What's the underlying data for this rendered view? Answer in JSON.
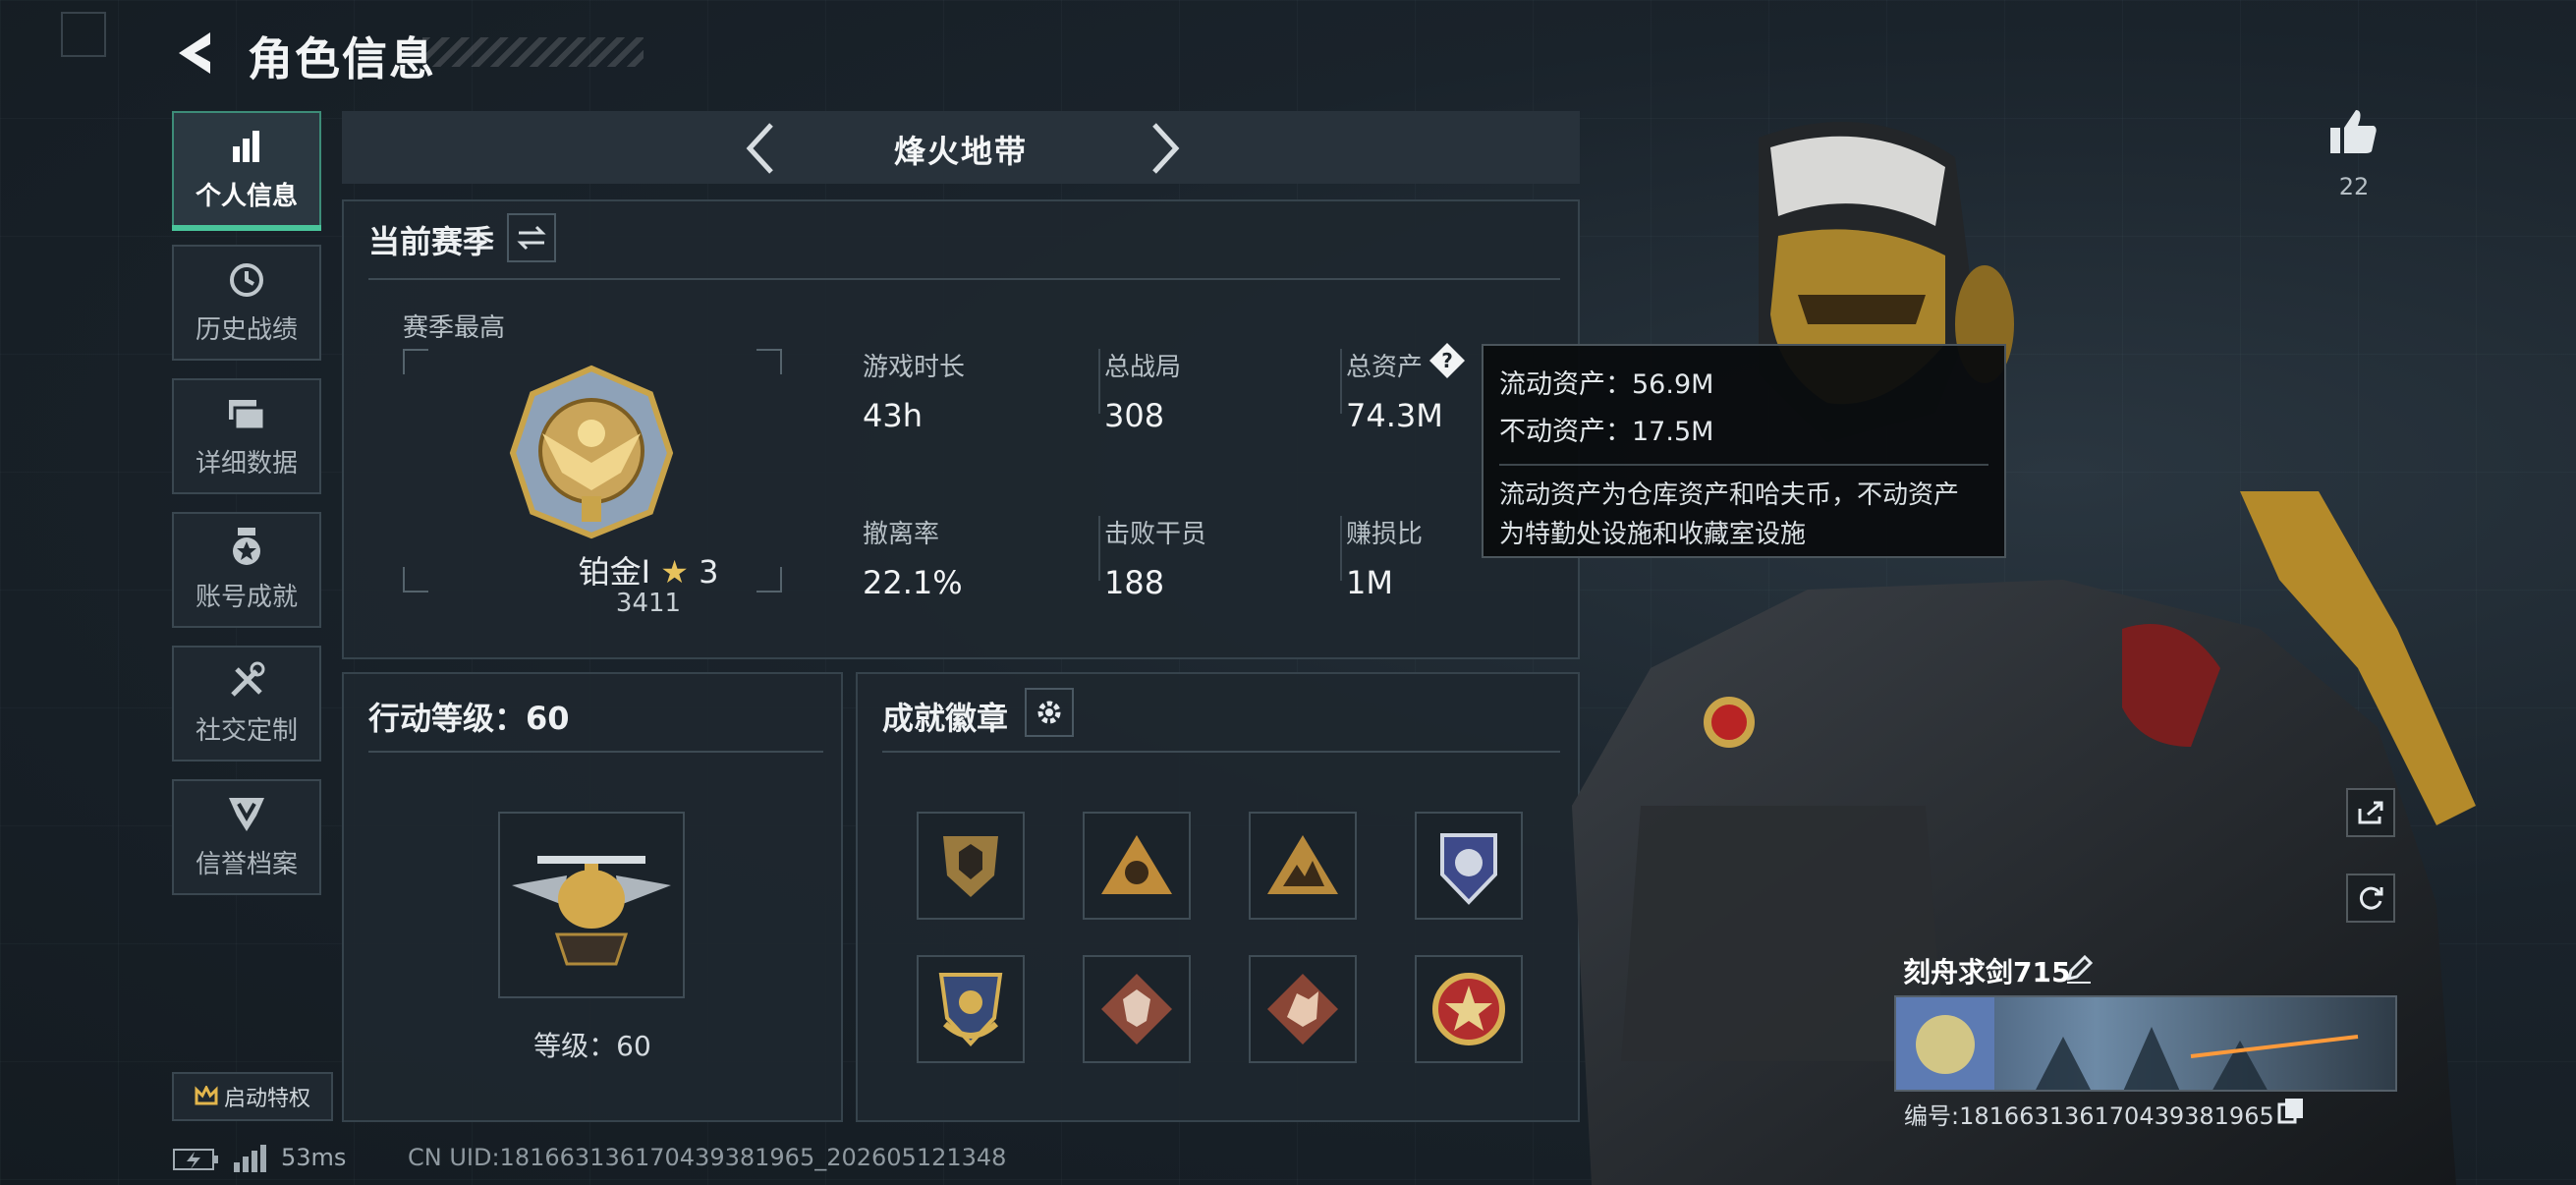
{
  "header": {
    "title": "角色信息"
  },
  "sidebar": {
    "items": [
      {
        "label": "个人信息",
        "icon": "bar-chart-icon",
        "active": true
      },
      {
        "label": "历史战绩",
        "icon": "clock-icon",
        "active": false
      },
      {
        "label": "详细数据",
        "icon": "cards-icon",
        "active": false
      },
      {
        "label": "账号成就",
        "icon": "medal-icon",
        "active": false
      },
      {
        "label": "社交定制",
        "icon": "tools-icon",
        "active": false
      },
      {
        "label": "信誉档案",
        "icon": "shield-star-icon",
        "active": false
      }
    ],
    "start_privilege": "启动特权"
  },
  "mode": {
    "title": "烽火地带"
  },
  "season": {
    "title": "当前赛季",
    "best_label": "赛季最高",
    "rank_name": "铂金Ⅰ",
    "rank_stars": "3",
    "rank_score": "3411",
    "stats": [
      {
        "label": "游戏时长",
        "value": "43h"
      },
      {
        "label": "总战局",
        "value": "308"
      },
      {
        "label": "总资产",
        "value": "74.3M"
      },
      {
        "label": "撤离率",
        "value": "22.1%"
      },
      {
        "label": "击败干员",
        "value": "188"
      },
      {
        "label": "赚损比",
        "value": "1M"
      }
    ]
  },
  "tooltip": {
    "liquid": "流动资产：56.9M",
    "fixed": "不动资产：17.5M",
    "desc_line1": "流动资产为仓库资产和哈夫币，不动资产",
    "desc_line2": "为特勤处设施和收藏室设施"
  },
  "level": {
    "title": "行动等级：60",
    "label": "等级：60"
  },
  "badges": {
    "title": "成就徽章",
    "items": [
      "shield-badge-icon",
      "triangle-badge-icon",
      "mountain-badge-icon",
      "police-badge-icon",
      "eagle-badge-icon",
      "wolf-badge-icon",
      "dragon-badge-icon",
      "star-badge-icon"
    ]
  },
  "player": {
    "name": "刻舟求剑715",
    "id_line": "编号:1816631361704393819​65",
    "likes": "22"
  },
  "footer": {
    "ping": "53ms",
    "uid": "CN UID:18166313617043​9381965_202605121348"
  },
  "colors": {
    "accent": "#49c49a",
    "panel": "#1e272f",
    "gold": "#c9a44a"
  }
}
